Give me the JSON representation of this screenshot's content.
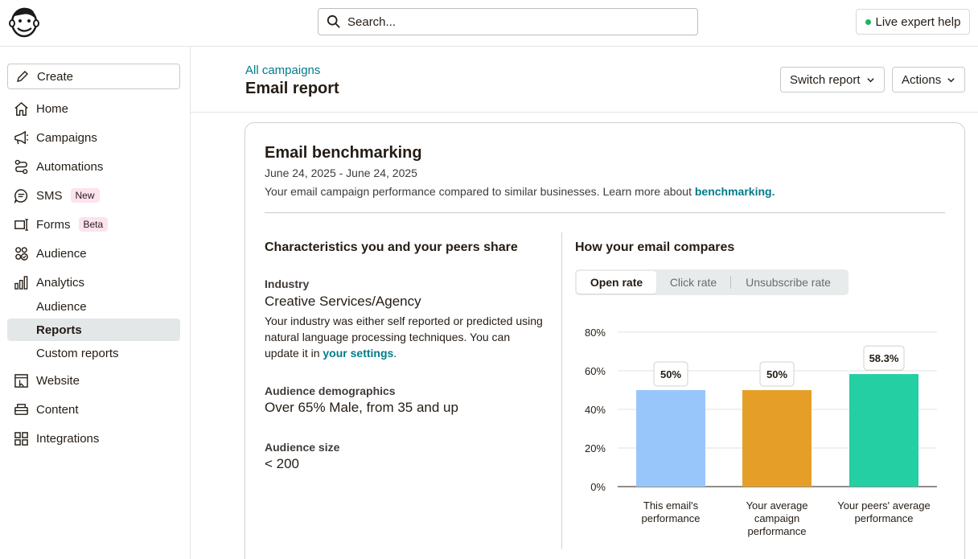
{
  "topbar": {
    "search_placeholder": "Search...",
    "expert_label": "Live expert help"
  },
  "sidebar": {
    "create_label": "Create",
    "items": [
      {
        "label": "Home",
        "icon": "home-icon"
      },
      {
        "label": "Campaigns",
        "icon": "megaphone-icon"
      },
      {
        "label": "Automations",
        "icon": "automation-icon"
      },
      {
        "label": "SMS",
        "icon": "sms-icon",
        "badge": "New"
      },
      {
        "label": "Forms",
        "icon": "forms-icon",
        "badge": "Beta"
      },
      {
        "label": "Audience",
        "icon": "audience-icon"
      },
      {
        "label": "Analytics",
        "icon": "analytics-icon"
      },
      {
        "label": "Website",
        "icon": "website-icon"
      },
      {
        "label": "Content",
        "icon": "content-icon"
      },
      {
        "label": "Integrations",
        "icon": "integrations-icon"
      }
    ],
    "analytics_sub": [
      "Audience",
      "Reports",
      "Custom reports"
    ],
    "active_sub": "Reports"
  },
  "header": {
    "breadcrumb": "All campaigns",
    "title": "Email report",
    "switch_report": "Switch report",
    "actions": "Actions"
  },
  "card": {
    "title": "Email benchmarking",
    "dates": "June 24, 2025 - June 24, 2025",
    "desc_prefix": "Your email campaign performance compared to similar businesses. Learn more about ",
    "desc_link": "benchmarking.",
    "left": {
      "title": "Characteristics you and your peers share",
      "industry_label": "Industry",
      "industry_value": "Creative Services/Agency",
      "industry_note_prefix": "Your industry was either self reported or predicted using natural language processing techniques. You can update it in ",
      "industry_note_link": "your settings",
      "industry_note_suffix": ".",
      "demo_label": "Audience demographics",
      "demo_value": "Over 65% Male, from 35 and up",
      "size_label": "Audience size",
      "size_value": "< 200"
    },
    "right": {
      "title": "How your email compares",
      "tabs": [
        "Open rate",
        "Click rate",
        "Unsubscribe rate"
      ],
      "active_tab": "Open rate"
    }
  },
  "chart_data": {
    "type": "bar",
    "categories": [
      "This email's performance",
      "Your average campaign performance",
      "Your peers' average performance"
    ],
    "category_lines": [
      [
        "This email's",
        "performance"
      ],
      [
        "Your average",
        "campaign",
        "performance"
      ],
      [
        "Your peers' average",
        "performance"
      ]
    ],
    "values": [
      50,
      50,
      58.3
    ],
    "data_labels": [
      "50%",
      "50%",
      "58.3%"
    ],
    "colors": [
      "#99c6fa",
      "#e59f28",
      "#23cfa3"
    ],
    "ylim": [
      0,
      80
    ],
    "yticks": [
      "0%",
      "20%",
      "40%",
      "60%",
      "80%"
    ],
    "grid": true
  }
}
